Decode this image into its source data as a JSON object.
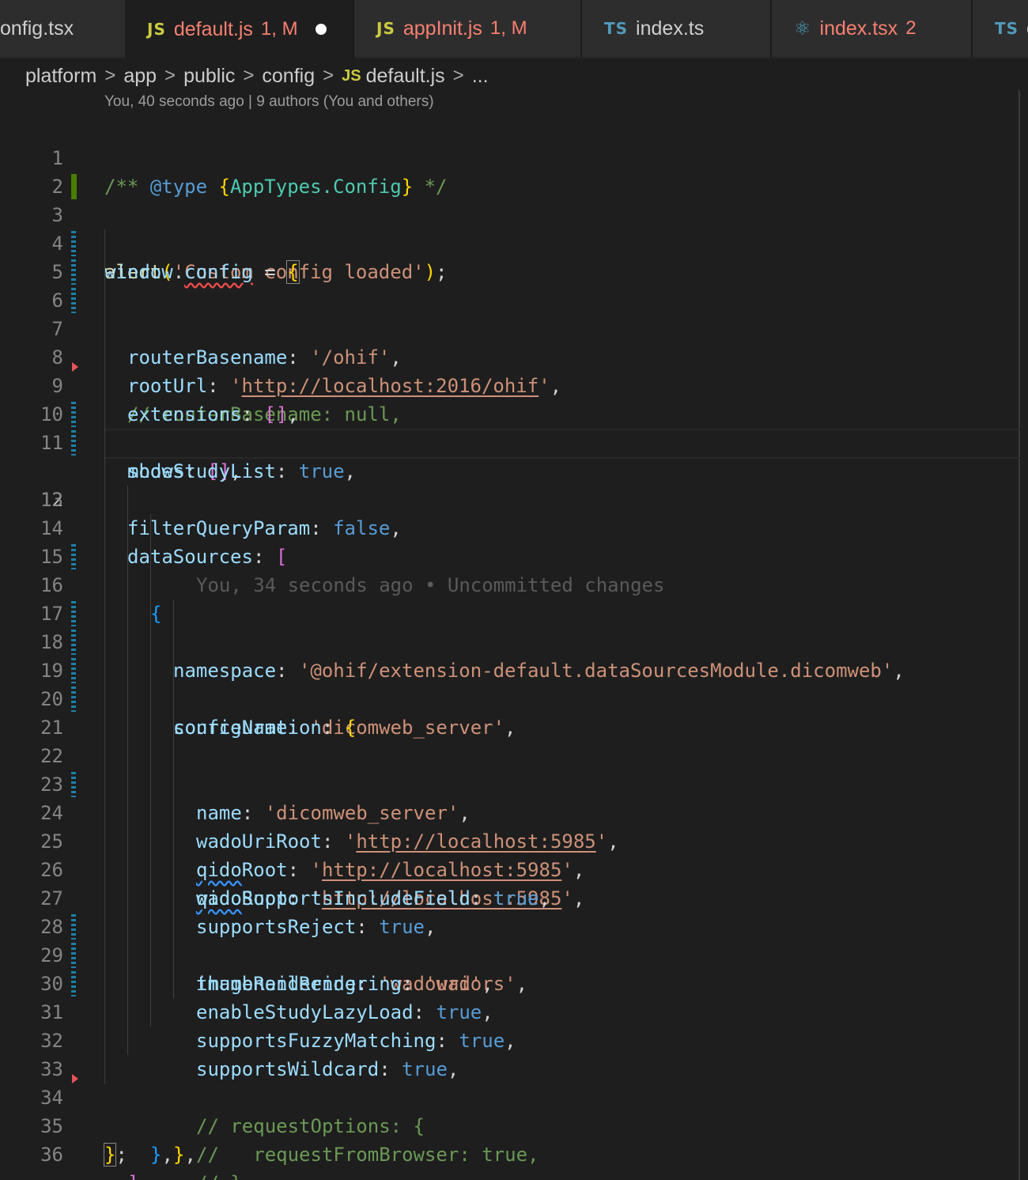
{
  "tabs": [
    {
      "lang": "",
      "label": "onfig.tsx",
      "status": "",
      "active": false
    },
    {
      "lang": "JS",
      "label": "default.js",
      "status": "1, M",
      "active": true,
      "dirty": true
    },
    {
      "lang": "JS",
      "label": "appInit.js",
      "status": "1, M",
      "active": false
    },
    {
      "lang": "TS",
      "label": "index.ts",
      "status": "",
      "active": false
    },
    {
      "lang": "react",
      "label": "index.tsx",
      "status": "2",
      "active": false
    },
    {
      "lang": "TS",
      "label": "c",
      "status": "",
      "active": false
    }
  ],
  "breadcrumb": {
    "items": [
      "platform",
      "app",
      "public",
      "config"
    ],
    "file_lang": "JS",
    "file": "default.js",
    "more": "..."
  },
  "blame_header": "You, 40 seconds ago | 9 authors (You and others)",
  "current_line": 12,
  "inline_blame": "You, 34 seconds ago • Uncommitted changes",
  "line_numbers": [
    "1",
    "2",
    "3",
    "4",
    "5",
    "6",
    "7",
    "8",
    "9",
    "10",
    "11",
    "12",
    "13",
    "14",
    "15",
    "16",
    "17",
    "18",
    "19",
    "20",
    "21",
    "22",
    "23",
    "24",
    "25",
    "26",
    "27",
    "28",
    "29",
    "30",
    "31",
    "32",
    "33",
    "34",
    "35",
    "36"
  ],
  "code": {
    "l1": {
      "c1": "/** ",
      "c2": "@type",
      "c3": " ",
      "c4": "{",
      "c5": "AppTypes.Config",
      "c6": "}",
      "c7": " */"
    },
    "l3": {
      "fn": "alert",
      "p1": "(",
      "s": "'Custom config loaded'",
      "p2": ")",
      "p3": ";"
    },
    "l4": {
      "v1": "window",
      "dot": ".",
      "v2": "config",
      "eq": " = ",
      "b": "{"
    },
    "l5": {
      "k": "routerBasename",
      "c": ": ",
      "s": "'/ohif'",
      "e": ","
    },
    "l6": {
      "k": "rootUrl",
      "c": ": ",
      "q1": "'",
      "u": "http://localhost:2016/ohif",
      "q2": "'",
      "e": ","
    },
    "l7": {
      "cm": "// routerBasename: null,"
    },
    "l8": {
      "k": "extensions",
      "c": ": ",
      "b": "[]",
      "e": ","
    },
    "l9": {
      "k": "modes",
      "c": ": ",
      "b": "[]",
      "e": ","
    },
    "l10": {
      "k": "showStudyList",
      "c": ": ",
      "v": "true",
      "e": ","
    },
    "l11": {
      "k": "filterQueryParam",
      "c": ": ",
      "v": "false",
      "e": ","
    },
    "l13": {
      "k": "dataSources",
      "c": ": ",
      "b": "["
    },
    "l14": {
      "b": "{"
    },
    "l15": {
      "k": "namespace",
      "c": ": ",
      "s": "'@ohif/extension-default.dataSourcesModule.dicomweb'",
      "e": ","
    },
    "l16": {
      "k": "sourceName",
      "c": ": ",
      "s": "'dicomweb_server'",
      "e": ","
    },
    "l17": {
      "k": "configuration",
      "c": ": ",
      "b": "{"
    },
    "l18": {
      "k": "name",
      "c": ": ",
      "s": "'dicomweb_server'",
      "e": ","
    },
    "l19": {
      "k": "wadoUriRoot",
      "c": ": ",
      "q1": "'",
      "u": "http://localhost:5985",
      "q2": "'",
      "e": ","
    },
    "l20": {
      "k1": "qido",
      "k2": "Root",
      "c": ": ",
      "q1": "'",
      "u": "http://localhost:5985",
      "q2": "'",
      "e": ","
    },
    "l21": {
      "k": "wadoRoot",
      "c": ": ",
      "q1": "'",
      "u": "http://localhost:5985",
      "q2": "'",
      "e": ","
    },
    "l22": {
      "k1": "qido",
      "k2": "SupportsIncludeField",
      "c": ": ",
      "v": "true",
      "e": ","
    },
    "l23": {
      "k": "supportsReject",
      "c": ": ",
      "v": "true",
      "e": ","
    },
    "l24": {
      "k": "imageRendering",
      "c": ": ",
      "s": "'wadouri'",
      "e": ","
    },
    "l25": {
      "k": "thumbnailRendering",
      "c": ": ",
      "s": "'wadors'",
      "e": ","
    },
    "l26": {
      "k": "enableStudyLazyLoad",
      "c": ": ",
      "v": "true",
      "e": ","
    },
    "l27": {
      "k": "supportsFuzzyMatching",
      "c": ": ",
      "v": "true",
      "e": ","
    },
    "l28": {
      "k": "supportsWildcard",
      "c": ": ",
      "v": "true",
      "e": ","
    },
    "l29": {
      "cm": "// requestOptions: {"
    },
    "l30": {
      "cm": "//   requestFromBrowser: true,"
    },
    "l31": {
      "cm": "// },"
    },
    "l32": {
      "b": "}",
      "e": ","
    },
    "l33": {
      "b": "}",
      "e": ","
    },
    "l34": {
      "b": "]",
      "e": ","
    },
    "l35": {
      "b": "}",
      "e": ";"
    }
  },
  "colors": {
    "background": "#1e1e1e",
    "git_added": "#487e02",
    "git_modified": "#1b81a8",
    "git_deleted": "#e8535b"
  }
}
